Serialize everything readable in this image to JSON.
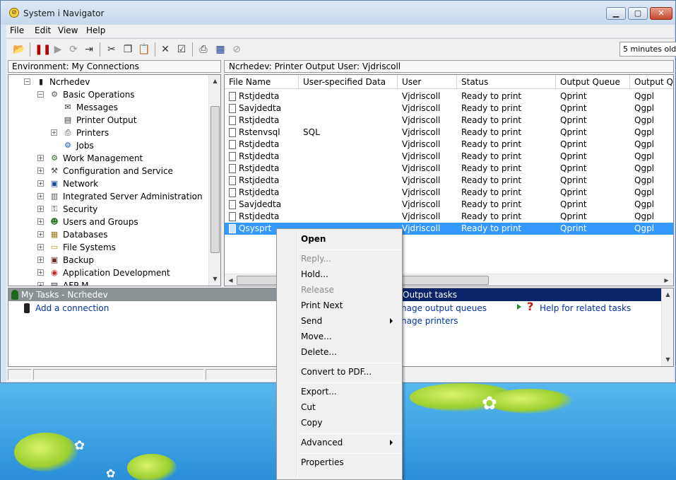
{
  "window": {
    "title": "System i Navigator",
    "min_glyph": "▁",
    "max_glyph": "▢",
    "close_glyph": "✕"
  },
  "menubar": [
    "File",
    "Edit",
    "View",
    "Help"
  ],
  "toolbar": {
    "refresh_status": "5 minutes old",
    "icons": [
      "open-folder-icon",
      "stop-icon",
      "play-icon",
      "connect-icon",
      "export-icon",
      "cut-icon",
      "copy-icon",
      "paste-icon",
      "delete-icon",
      "properties-icon",
      "print-icon",
      "options-icon",
      "cancel-icon"
    ]
  },
  "left": {
    "environment": "Environment: My Connections",
    "tree": [
      {
        "label": "Ncrhedev",
        "icon": "server-icon",
        "level": 0,
        "expander": "−"
      },
      {
        "label": "Basic Operations",
        "icon": "basic-operations-icon",
        "level": 1,
        "expander": "−"
      },
      {
        "label": "Messages",
        "icon": "messages-icon",
        "level": 2,
        "expander": ""
      },
      {
        "label": "Printer Output",
        "icon": "printer-output-icon",
        "level": 2,
        "expander": ""
      },
      {
        "label": "Printers",
        "icon": "printers-icon",
        "level": 2,
        "expander": "+"
      },
      {
        "label": "Jobs",
        "icon": "jobs-icon",
        "level": 2,
        "expander": ""
      },
      {
        "label": "Work Management",
        "icon": "work-management-icon",
        "level": 1,
        "expander": "+"
      },
      {
        "label": "Configuration and Service",
        "icon": "configuration-icon",
        "level": 1,
        "expander": "+"
      },
      {
        "label": "Network",
        "icon": "network-icon",
        "level": 1,
        "expander": "+"
      },
      {
        "label": "Integrated Server Administration",
        "icon": "integrated-server-icon",
        "level": 1,
        "expander": "+"
      },
      {
        "label": "Security",
        "icon": "security-icon",
        "level": 1,
        "expander": "+"
      },
      {
        "label": "Users and Groups",
        "icon": "users-groups-icon",
        "level": 1,
        "expander": "+"
      },
      {
        "label": "Databases",
        "icon": "databases-icon",
        "level": 1,
        "expander": "+"
      },
      {
        "label": "File Systems",
        "icon": "file-systems-icon",
        "level": 1,
        "expander": "+"
      },
      {
        "label": "Backup",
        "icon": "backup-icon",
        "level": 1,
        "expander": "+"
      },
      {
        "label": "Application Development",
        "icon": "application-development-icon",
        "level": 1,
        "expander": "+"
      },
      {
        "label": "AFP M...",
        "icon": "afp-icon",
        "level": 1,
        "expander": "+"
      }
    ]
  },
  "right": {
    "path": "Ncrhedev:  Printer Output     User: Vjdriscoll",
    "columns": [
      "File Name",
      "User-specified Data",
      "User",
      "Status",
      "Output Queue",
      "Output Queue Library"
    ],
    "rows": [
      {
        "file": "Rstjdedta",
        "data": "",
        "user": "Vjdriscoll",
        "status": "Ready to print",
        "queue": "Qprint",
        "lib": "Qgpl"
      },
      {
        "file": "Savjdedta",
        "data": "",
        "user": "Vjdriscoll",
        "status": "Ready to print",
        "queue": "Qprint",
        "lib": "Qgpl"
      },
      {
        "file": "Rstjdedta",
        "data": "",
        "user": "Vjdriscoll",
        "status": "Ready to print",
        "queue": "Qprint",
        "lib": "Qgpl"
      },
      {
        "file": "Rstenvsql",
        "data": "SQL",
        "user": "Vjdriscoll",
        "status": "Ready to print",
        "queue": "Qprint",
        "lib": "Qgpl"
      },
      {
        "file": "Rstjdedta",
        "data": "",
        "user": "Vjdriscoll",
        "status": "Ready to print",
        "queue": "Qprint",
        "lib": "Qgpl"
      },
      {
        "file": "Rstjdedta",
        "data": "",
        "user": "Vjdriscoll",
        "status": "Ready to print",
        "queue": "Qprint",
        "lib": "Qgpl"
      },
      {
        "file": "Rstjdedta",
        "data": "",
        "user": "Vjdriscoll",
        "status": "Ready to print",
        "queue": "Qprint",
        "lib": "Qgpl"
      },
      {
        "file": "Rstjdedta",
        "data": "",
        "user": "Vjdriscoll",
        "status": "Ready to print",
        "queue": "Qprint",
        "lib": "Qgpl"
      },
      {
        "file": "Rstjdedta",
        "data": "",
        "user": "Vjdriscoll",
        "status": "Ready to print",
        "queue": "Qprint",
        "lib": "Qgpl"
      },
      {
        "file": "Savjdedta",
        "data": "",
        "user": "Vjdriscoll",
        "status": "Ready to print",
        "queue": "Qprint",
        "lib": "Qgpl"
      },
      {
        "file": "Rstjdedta",
        "data": "",
        "user": "Vjdriscoll",
        "status": "Ready to print",
        "queue": "Qprint",
        "lib": "Qgpl"
      },
      {
        "file": "Qsysprt",
        "data": "",
        "user": "Vjdriscoll",
        "status": "Ready to print",
        "queue": "Qprint",
        "lib": "Qgpl",
        "selected": true
      }
    ]
  },
  "tasks": {
    "my_tasks_header": "My Tasks - Ncrhedev",
    "add_connection": "Add a connection",
    "output_tasks_header": "Output tasks",
    "manage_output_queues": "nage output queues",
    "manage_printers": "nage printers",
    "help_related": "Help for related tasks"
  },
  "context_menu": [
    {
      "label": "Open",
      "bold": true
    },
    {
      "sep": true
    },
    {
      "label": "Reply...",
      "disabled": true
    },
    {
      "label": "Hold..."
    },
    {
      "label": "Release",
      "disabled": true
    },
    {
      "label": "Print Next"
    },
    {
      "label": "Send",
      "submenu": true
    },
    {
      "label": "Move..."
    },
    {
      "label": "Delete..."
    },
    {
      "sep": true
    },
    {
      "label": "Convert to PDF..."
    },
    {
      "sep": true
    },
    {
      "label": "Export..."
    },
    {
      "label": "Cut"
    },
    {
      "label": "Copy"
    },
    {
      "sep": true
    },
    {
      "label": "Advanced",
      "submenu": true
    },
    {
      "sep": true
    },
    {
      "label": "Properties"
    }
  ]
}
